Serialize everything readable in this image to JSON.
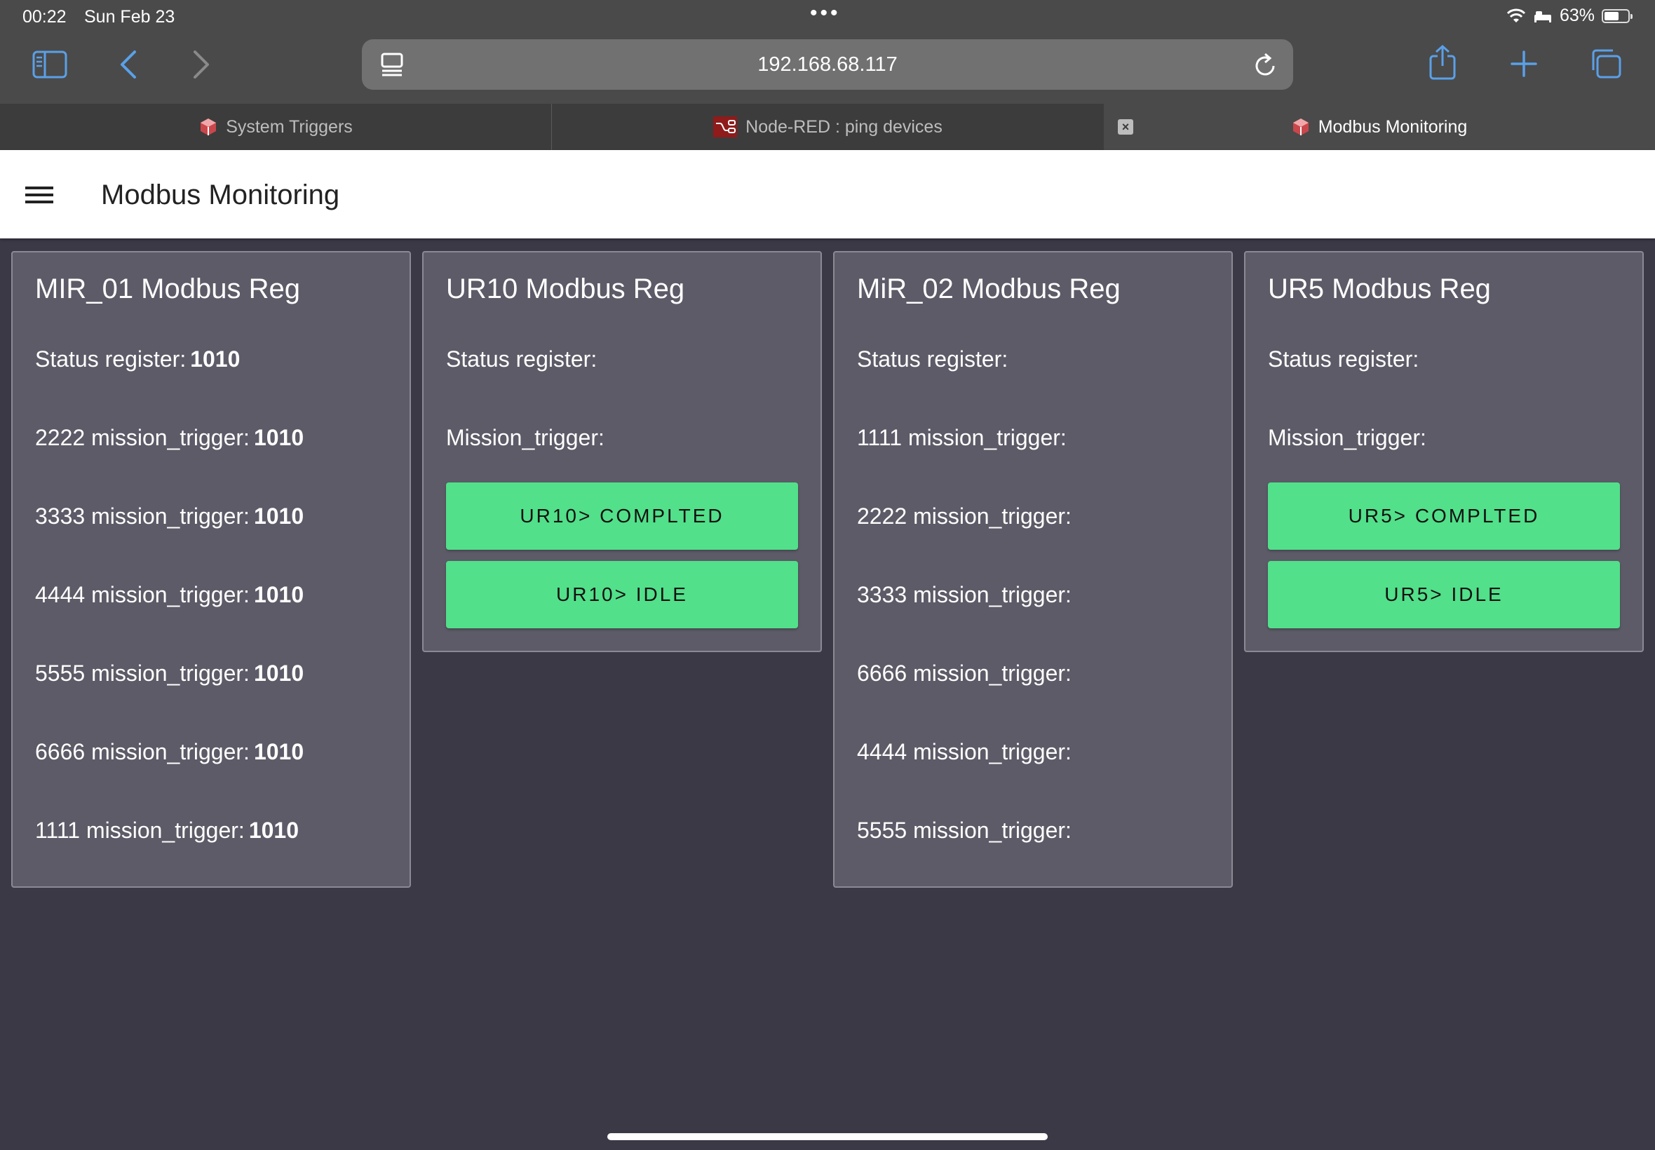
{
  "status_bar": {
    "time": "00:22",
    "date": "Sun Feb 23",
    "battery": "63%",
    "battery_level": 0.63
  },
  "browser": {
    "url": "192.168.68.117",
    "accent": "#5aa0e8",
    "tabs": [
      {
        "label": "System Triggers",
        "icon": "node-red-cube-icon"
      },
      {
        "label": "Node-RED : ping devices",
        "icon": "node-red-logo-icon"
      },
      {
        "label": "Modbus Monitoring",
        "icon": "node-red-cube-icon"
      }
    ]
  },
  "page": {
    "title": "Modbus Monitoring"
  },
  "cards": [
    {
      "title": "MIR_01 Modbus Reg",
      "rows": [
        {
          "label": "Status register:",
          "value": "1010"
        },
        {
          "label": "2222 mission_trigger:",
          "value": "1010"
        },
        {
          "label": "3333 mission_trigger:",
          "value": "1010"
        },
        {
          "label": "4444 mission_trigger:",
          "value": "1010"
        },
        {
          "label": "5555 mission_trigger:",
          "value": "1010"
        },
        {
          "label": "6666 mission_trigger:",
          "value": "1010"
        },
        {
          "label": "1111 mission_trigger:",
          "value": "1010"
        }
      ]
    },
    {
      "title": "UR10 Modbus Reg",
      "rows": [
        {
          "label": "Status register:",
          "value": ""
        },
        {
          "label": "Mission_trigger:",
          "value": ""
        }
      ],
      "buttons": [
        "UR10> COMPLTED",
        "UR10> IDLE"
      ]
    },
    {
      "title": "MiR_02 Modbus Reg",
      "rows": [
        {
          "label": "Status register:",
          "value": ""
        },
        {
          "label": "1111 mission_trigger:",
          "value": ""
        },
        {
          "label": "2222 mission_trigger:",
          "value": ""
        },
        {
          "label": "3333 mission_trigger:",
          "value": ""
        },
        {
          "label": "6666 mission_trigger:",
          "value": ""
        },
        {
          "label": "4444 mission_trigger:",
          "value": ""
        },
        {
          "label": "5555 mission_trigger:",
          "value": ""
        }
      ]
    },
    {
      "title": "UR5 Modbus Reg",
      "rows": [
        {
          "label": "Status register:",
          "value": ""
        },
        {
          "label": "Mission_trigger:",
          "value": ""
        }
      ],
      "buttons": [
        "UR5> COMPLTED",
        "UR5> IDLE"
      ]
    }
  ],
  "colors": {
    "page_bg": "#3c3947",
    "card_bg": "#5c5b67",
    "button_green": "#52e08a"
  }
}
